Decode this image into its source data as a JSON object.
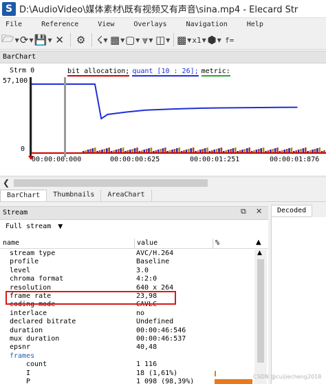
{
  "window": {
    "title": "D:\\AudioVideo\\媒体素材\\既有视频又有声音\\sina.mp4 - Elecard Str"
  },
  "menu": [
    "File",
    "Reference",
    "View",
    "Overlays",
    "Navigation",
    "Help"
  ],
  "toolbar": {
    "zoom": "x1",
    "func": "f="
  },
  "barchart": {
    "panel_title": "BarChart",
    "y_axis_label": "Strm 0",
    "legend": {
      "bit": "bit allocation;",
      "quant": "quant [10 : 26];",
      "metric": "metric:"
    },
    "colors": {
      "bit": "#d00000",
      "quant": "#1e2fd8",
      "metric": "#28a828"
    }
  },
  "chart_data": {
    "type": "line",
    "ylim": [
      0,
      57100
    ],
    "y_ticks": [
      "57,100",
      "0"
    ],
    "x_ticks": [
      "00:00:00:000",
      "00:00:00:625",
      "00:00:01:251",
      "00:00:01:876"
    ],
    "series": [
      {
        "name": "quant [10 : 26]",
        "x": [
          0,
          0.03,
          0.06,
          0.25,
          0.45,
          0.5,
          0.55,
          0.6,
          0.75,
          0.9,
          1.05,
          1.2,
          1.35,
          1.5,
          1.65,
          1.8,
          1.95,
          2.1
        ],
        "values": [
          57100,
          57100,
          57100,
          57100,
          57100,
          57100,
          28500,
          32000,
          34000,
          35500,
          36200,
          36800,
          37200,
          37400,
          37600,
          37700,
          37800,
          37900
        ]
      }
    ]
  },
  "tabs": [
    "BarChart",
    "Thumbnails",
    "AreaChart"
  ],
  "stream": {
    "panel_title": "Stream",
    "selected": "Full stream",
    "columns": {
      "name": "name",
      "value": "value",
      "percent": "%"
    },
    "rows": [
      {
        "name": "stream type",
        "value": "AVC/H.264"
      },
      {
        "name": "profile",
        "value": "Baseline"
      },
      {
        "name": "level",
        "value": "3.0"
      },
      {
        "name": "chroma format",
        "value": "4:2:0"
      },
      {
        "name": "resolution",
        "value": "640 x 264"
      },
      {
        "name": "frame rate",
        "value": "23,98"
      },
      {
        "name": "coding mode",
        "value": "CAVLC"
      },
      {
        "name": "interlace",
        "value": "no"
      },
      {
        "name": "declared bitrate",
        "value": "Undefined"
      },
      {
        "name": "duration",
        "value": "00:00:46:546"
      },
      {
        "name": "mux duration",
        "value": "00:00:46:537"
      },
      {
        "name": "epsnr",
        "value": "40,48"
      },
      {
        "name": "frames",
        "value": ""
      },
      {
        "name": "count",
        "value": "1 116"
      },
      {
        "name": "I",
        "value": "18 (1,61%)",
        "percent": 0.0161
      },
      {
        "name": "P",
        "value": "1 098 (98,39%)",
        "percent": 0.9839
      }
    ]
  },
  "decoded": {
    "tab_label": "Decoded"
  },
  "watermark": "CSDN @cuijiecheng2018"
}
